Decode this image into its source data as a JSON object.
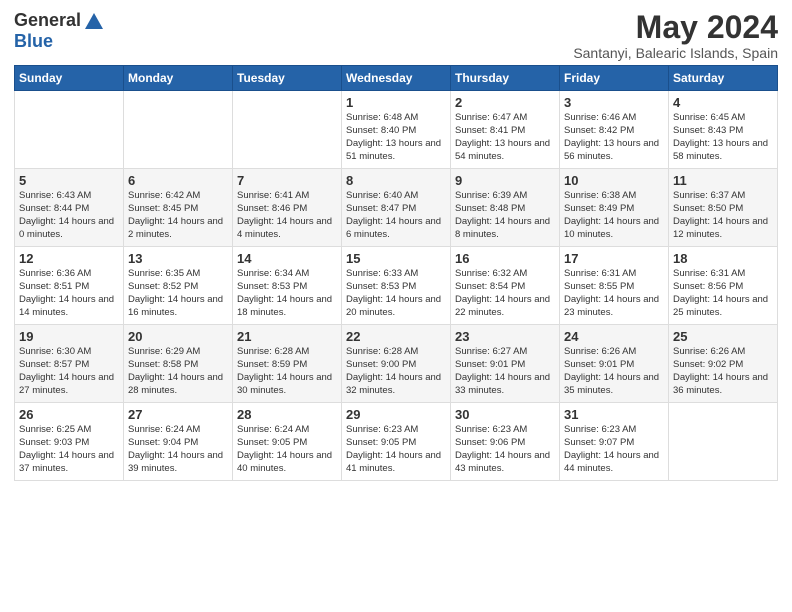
{
  "header": {
    "logo_general": "General",
    "logo_blue": "Blue",
    "month_title": "May 2024",
    "subtitle": "Santanyi, Balearic Islands, Spain"
  },
  "days_of_week": [
    "Sunday",
    "Monday",
    "Tuesday",
    "Wednesday",
    "Thursday",
    "Friday",
    "Saturday"
  ],
  "weeks": [
    [
      {
        "day": "",
        "sunrise": "",
        "sunset": "",
        "daylight": ""
      },
      {
        "day": "",
        "sunrise": "",
        "sunset": "",
        "daylight": ""
      },
      {
        "day": "",
        "sunrise": "",
        "sunset": "",
        "daylight": ""
      },
      {
        "day": "1",
        "sunrise": "Sunrise: 6:48 AM",
        "sunset": "Sunset: 8:40 PM",
        "daylight": "Daylight: 13 hours and 51 minutes."
      },
      {
        "day": "2",
        "sunrise": "Sunrise: 6:47 AM",
        "sunset": "Sunset: 8:41 PM",
        "daylight": "Daylight: 13 hours and 54 minutes."
      },
      {
        "day": "3",
        "sunrise": "Sunrise: 6:46 AM",
        "sunset": "Sunset: 8:42 PM",
        "daylight": "Daylight: 13 hours and 56 minutes."
      },
      {
        "day": "4",
        "sunrise": "Sunrise: 6:45 AM",
        "sunset": "Sunset: 8:43 PM",
        "daylight": "Daylight: 13 hours and 58 minutes."
      }
    ],
    [
      {
        "day": "5",
        "sunrise": "Sunrise: 6:43 AM",
        "sunset": "Sunset: 8:44 PM",
        "daylight": "Daylight: 14 hours and 0 minutes."
      },
      {
        "day": "6",
        "sunrise": "Sunrise: 6:42 AM",
        "sunset": "Sunset: 8:45 PM",
        "daylight": "Daylight: 14 hours and 2 minutes."
      },
      {
        "day": "7",
        "sunrise": "Sunrise: 6:41 AM",
        "sunset": "Sunset: 8:46 PM",
        "daylight": "Daylight: 14 hours and 4 minutes."
      },
      {
        "day": "8",
        "sunrise": "Sunrise: 6:40 AM",
        "sunset": "Sunset: 8:47 PM",
        "daylight": "Daylight: 14 hours and 6 minutes."
      },
      {
        "day": "9",
        "sunrise": "Sunrise: 6:39 AM",
        "sunset": "Sunset: 8:48 PM",
        "daylight": "Daylight: 14 hours and 8 minutes."
      },
      {
        "day": "10",
        "sunrise": "Sunrise: 6:38 AM",
        "sunset": "Sunset: 8:49 PM",
        "daylight": "Daylight: 14 hours and 10 minutes."
      },
      {
        "day": "11",
        "sunrise": "Sunrise: 6:37 AM",
        "sunset": "Sunset: 8:50 PM",
        "daylight": "Daylight: 14 hours and 12 minutes."
      }
    ],
    [
      {
        "day": "12",
        "sunrise": "Sunrise: 6:36 AM",
        "sunset": "Sunset: 8:51 PM",
        "daylight": "Daylight: 14 hours and 14 minutes."
      },
      {
        "day": "13",
        "sunrise": "Sunrise: 6:35 AM",
        "sunset": "Sunset: 8:52 PM",
        "daylight": "Daylight: 14 hours and 16 minutes."
      },
      {
        "day": "14",
        "sunrise": "Sunrise: 6:34 AM",
        "sunset": "Sunset: 8:53 PM",
        "daylight": "Daylight: 14 hours and 18 minutes."
      },
      {
        "day": "15",
        "sunrise": "Sunrise: 6:33 AM",
        "sunset": "Sunset: 8:53 PM",
        "daylight": "Daylight: 14 hours and 20 minutes."
      },
      {
        "day": "16",
        "sunrise": "Sunrise: 6:32 AM",
        "sunset": "Sunset: 8:54 PM",
        "daylight": "Daylight: 14 hours and 22 minutes."
      },
      {
        "day": "17",
        "sunrise": "Sunrise: 6:31 AM",
        "sunset": "Sunset: 8:55 PM",
        "daylight": "Daylight: 14 hours and 23 minutes."
      },
      {
        "day": "18",
        "sunrise": "Sunrise: 6:31 AM",
        "sunset": "Sunset: 8:56 PM",
        "daylight": "Daylight: 14 hours and 25 minutes."
      }
    ],
    [
      {
        "day": "19",
        "sunrise": "Sunrise: 6:30 AM",
        "sunset": "Sunset: 8:57 PM",
        "daylight": "Daylight: 14 hours and 27 minutes."
      },
      {
        "day": "20",
        "sunrise": "Sunrise: 6:29 AM",
        "sunset": "Sunset: 8:58 PM",
        "daylight": "Daylight: 14 hours and 28 minutes."
      },
      {
        "day": "21",
        "sunrise": "Sunrise: 6:28 AM",
        "sunset": "Sunset: 8:59 PM",
        "daylight": "Daylight: 14 hours and 30 minutes."
      },
      {
        "day": "22",
        "sunrise": "Sunrise: 6:28 AM",
        "sunset": "Sunset: 9:00 PM",
        "daylight": "Daylight: 14 hours and 32 minutes."
      },
      {
        "day": "23",
        "sunrise": "Sunrise: 6:27 AM",
        "sunset": "Sunset: 9:01 PM",
        "daylight": "Daylight: 14 hours and 33 minutes."
      },
      {
        "day": "24",
        "sunrise": "Sunrise: 6:26 AM",
        "sunset": "Sunset: 9:01 PM",
        "daylight": "Daylight: 14 hours and 35 minutes."
      },
      {
        "day": "25",
        "sunrise": "Sunrise: 6:26 AM",
        "sunset": "Sunset: 9:02 PM",
        "daylight": "Daylight: 14 hours and 36 minutes."
      }
    ],
    [
      {
        "day": "26",
        "sunrise": "Sunrise: 6:25 AM",
        "sunset": "Sunset: 9:03 PM",
        "daylight": "Daylight: 14 hours and 37 minutes."
      },
      {
        "day": "27",
        "sunrise": "Sunrise: 6:24 AM",
        "sunset": "Sunset: 9:04 PM",
        "daylight": "Daylight: 14 hours and 39 minutes."
      },
      {
        "day": "28",
        "sunrise": "Sunrise: 6:24 AM",
        "sunset": "Sunset: 9:05 PM",
        "daylight": "Daylight: 14 hours and 40 minutes."
      },
      {
        "day": "29",
        "sunrise": "Sunrise: 6:23 AM",
        "sunset": "Sunset: 9:05 PM",
        "daylight": "Daylight: 14 hours and 41 minutes."
      },
      {
        "day": "30",
        "sunrise": "Sunrise: 6:23 AM",
        "sunset": "Sunset: 9:06 PM",
        "daylight": "Daylight: 14 hours and 43 minutes."
      },
      {
        "day": "31",
        "sunrise": "Sunrise: 6:23 AM",
        "sunset": "Sunset: 9:07 PM",
        "daylight": "Daylight: 14 hours and 44 minutes."
      },
      {
        "day": "",
        "sunrise": "",
        "sunset": "",
        "daylight": ""
      }
    ]
  ]
}
